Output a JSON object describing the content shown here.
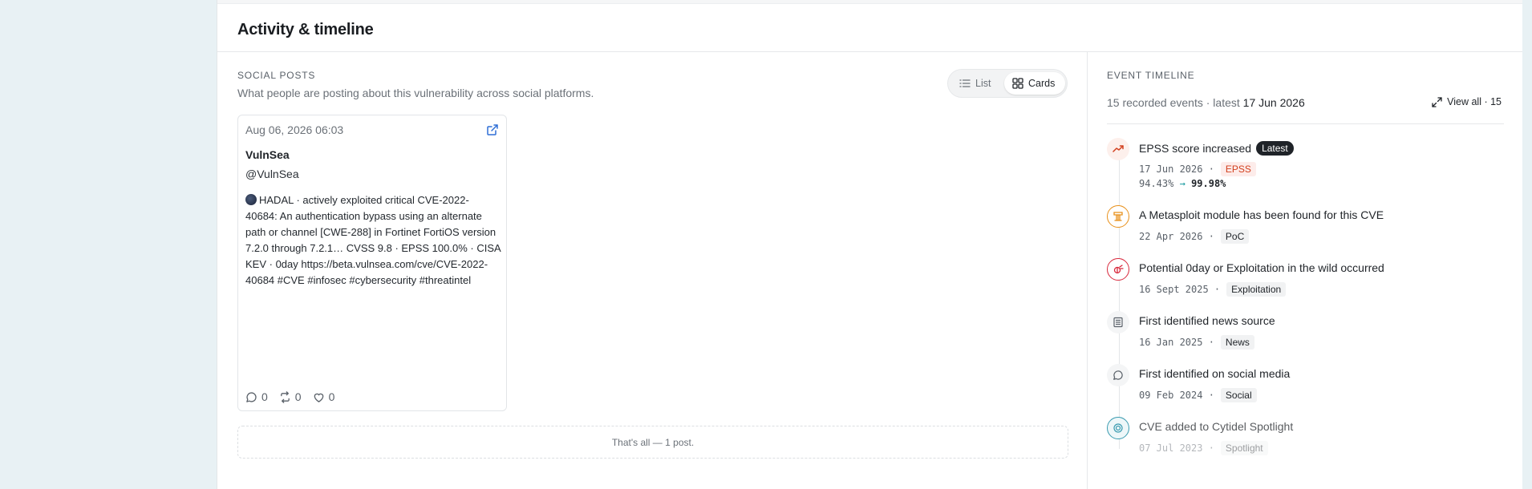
{
  "section": {
    "title": "Activity & timeline"
  },
  "social": {
    "label": "SOCIAL POSTS",
    "description": "What people are posting about this vulnerability across social platforms.",
    "view_toggle": {
      "list_label": "List",
      "cards_label": "Cards",
      "selected": "Cards"
    },
    "posts": [
      {
        "date": "Aug 06, 2026 06:03",
        "author": "VulnSea",
        "handle": "@VulnSea",
        "body": "HADAL · actively exploited critical CVE-2022-40684: An authentication bypass using an alternate path or channel [CWE-288] in Fortinet FortiOS version 7.2.0 through 7.2.1… CVSS 9.8 · EPSS 100.0% · CISA KEV · 0day https://beta.vulnsea.com/cve/CVE-2022-40684 #CVE #infosec #cybersecurity #threatintel",
        "replies": "0",
        "reposts": "0",
        "likes": "0"
      }
    ],
    "end_note": "That's all — 1 post."
  },
  "timeline": {
    "label": "EVENT TIMELINE",
    "summary_prefix": "15 recorded events · latest",
    "latest_date": "17 Jun 2026",
    "view_all": "View all · 15",
    "events": [
      {
        "title": "EPSS score increased",
        "badge": "Latest",
        "date": "17 Jun 2026 ·",
        "tag": "EPSS",
        "from": "94.43%",
        "arrow": "→",
        "to": "99.98%",
        "icon": "trend-up-icon",
        "color": "#d2401e"
      },
      {
        "title": "A Metasploit module has been found for this CVE",
        "date": "22 Apr 2026 ·",
        "tag": "PoC",
        "icon": "metasploit-icon",
        "color": "#e8901a"
      },
      {
        "title": "Potential 0day or Exploitation in the wild occurred",
        "date": "16 Sept 2025 ·",
        "tag": "Exploitation",
        "icon": "bug-icon",
        "color": "#d8283c"
      },
      {
        "title": "First identified news source",
        "date": "16 Jan 2025 ·",
        "tag": "News",
        "icon": "newspaper-icon",
        "color": "#5a6169"
      },
      {
        "title": "First identified on social media",
        "date": "09 Feb 2024 ·",
        "tag": "Social",
        "icon": "chat-bubble-icon",
        "color": "#5a6169"
      },
      {
        "title": "CVE added to Cytidel Spotlight",
        "date": "07 Jul 2023 ·",
        "tag": "Spotlight",
        "icon": "spotlight-icon",
        "color": "#3a9bb0"
      }
    ]
  }
}
